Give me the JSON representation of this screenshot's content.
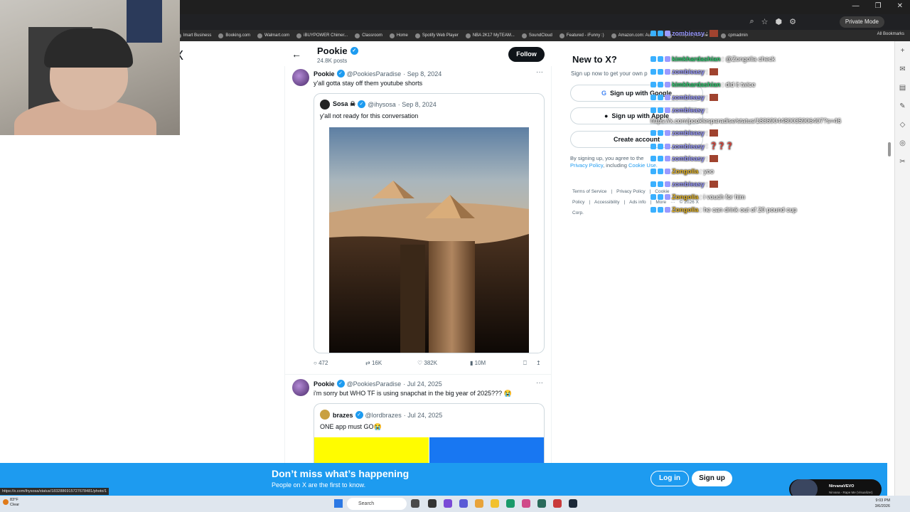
{
  "browser": {
    "private_label": "Private Mode",
    "bookmarks": [
      "lmart Business",
      "Booking.com",
      "Walmart.com",
      "iBUYPOWER Chimer...",
      "Classroom",
      "Home",
      "Spotify Web Player",
      "NBA 2K17 MyTEAM...",
      "SoundCloud",
      "Featured - iFunny :)",
      "Amazon.com: Audib...",
      "Photopea | Online I...",
      "cpmadmin"
    ],
    "all_bookmarks": "All Bookmarks",
    "status_url": "https://x.com/ihysosa/status/1832886915727678481/photo/1"
  },
  "header": {
    "x_logo": "X",
    "back": "←",
    "profile_name": "Pookie",
    "post_count": "24.8K posts",
    "follow_label": "Follow"
  },
  "tweets": [
    {
      "name": "Pookie",
      "handle": "@PookiesParadise",
      "date": "· Sep 8, 2024",
      "text": "y'all gotta stay off them youtube shorts",
      "quote": {
        "name": "Sosa ☠",
        "handle": "@ihysosa",
        "date": "· Sep 8, 2024",
        "text": "y'all not ready for this conversation"
      },
      "stats": {
        "replies": "472",
        "reposts": "16K",
        "likes": "382K",
        "views": "10M"
      }
    },
    {
      "name": "Pookie",
      "handle": "@PookiesParadise",
      "date": "· Jul 24, 2025",
      "text": "i'm sorry but WHO TF is using snapchat in the big year of 2025??? 😭",
      "quote": {
        "name": "brazes",
        "handle": "@lordbrazes",
        "date": "· Jul 24, 2025",
        "text": "ONE app must GO😭"
      }
    }
  ],
  "sidebar": {
    "title": "New to X?",
    "hint": "Sign up now to get your own p",
    "google_btn": "Sign up with Google",
    "apple_btn": "Sign up with Apple",
    "create_btn": "Create account",
    "terms_prefix": "By signing up, you agree to the",
    "privacy_link": "Privacy Policy",
    "terms_mid": ", including",
    "cookie_link": "Cookie Use.",
    "footer": [
      "Terms of Service",
      "|",
      "Privacy Policy",
      "|",
      "Cookie Policy",
      "|",
      "Accessibility",
      "|",
      "Ads info",
      "|",
      "More",
      "···",
      "© 2026 X Corp."
    ]
  },
  "chat": [
    {
      "user": "zombieasy",
      "msg": ":",
      "color": "#9a9aff",
      "emote": true
    },
    {
      "user": "kimkhardashian",
      "msg": ": @Zongolia check",
      "color": "#2ecc71",
      "emote": false
    },
    {
      "user": "zombieasy",
      "msg": ":",
      "color": "#9a9aff",
      "emote": true
    },
    {
      "user": "kimkhardashian",
      "msg": ": did it twice",
      "color": "#2ecc71",
      "emote": false
    },
    {
      "user": "zombieasy",
      "msg": ":",
      "color": "#9a9aff",
      "emote": true
    },
    {
      "user": "zombieasy",
      "msg": ":",
      "color": "#9a9aff",
      "emote": false
    },
    {
      "user": "",
      "msg": "https://x.com/pookiesparadise/status/1836904480035906407?s=46",
      "color": "#ffffff",
      "emote": false
    },
    {
      "user": "zombieasy",
      "msg": ":",
      "color": "#9a9aff",
      "emote": true
    },
    {
      "user": "zombieasy",
      "msg": ": ❓❓❓",
      "color": "#9a9aff",
      "emote": false
    },
    {
      "user": "zombieasy",
      "msg": ":",
      "color": "#9a9aff",
      "emote": true
    },
    {
      "user": "Zongolia",
      "msg": ": yoo",
      "color": "#e6b422",
      "emote": false
    },
    {
      "user": "zombieasy",
      "msg": ":",
      "color": "#9a9aff",
      "emote": true
    },
    {
      "user": "Zongolia",
      "msg": ": i vouch for him",
      "color": "#e6b422",
      "emote": false
    },
    {
      "user": "Zongolia",
      "msg": ": he can drink out of 20 pound cup",
      "color": "#e6b422",
      "emote": false
    }
  ],
  "banner": {
    "title": "Don’t miss what’s happening",
    "subtitle": "People on X are the first to know.",
    "login": "Log in",
    "signup": "Sign up"
  },
  "now_playing": {
    "title": "NirvanaVEVO",
    "subtitle": "Nirvana - Rape Me (Visualizer)"
  },
  "taskbar": {
    "weather_temp": "83°F",
    "weather_cond": "Clear",
    "search_placeholder": "Search",
    "time": "9:03 PM",
    "date": "3/6/2026"
  },
  "colors": {
    "x_blue": "#1d9bf0",
    "banner_bg": "#1d9bf0",
    "dark": "#0f1419"
  }
}
